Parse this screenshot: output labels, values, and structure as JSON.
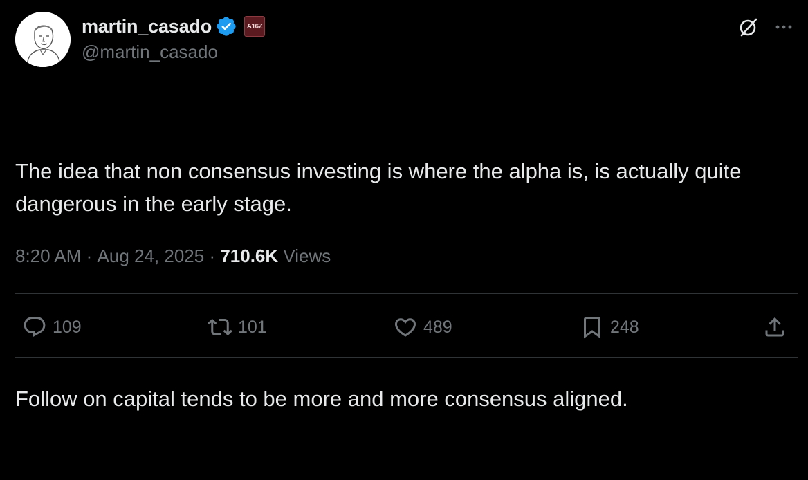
{
  "author": {
    "display_name": "martin_casado",
    "handle": "@martin_casado",
    "verified_icon": "verified-check-icon",
    "affiliation_badge_text": "A16Z"
  },
  "tweet": {
    "paragraphs": [
      "The idea that non consensus investing is where the alpha is, is actually quite dangerous in the early stage.",
      "Follow on capital tends to be more and more consensus aligned."
    ]
  },
  "meta": {
    "time": "8:20 AM",
    "separator": " · ",
    "date": "Aug 24, 2025",
    "views_count": "710.6K",
    "views_label": " Views"
  },
  "actions": {
    "reply_count": "109",
    "retweet_count": "101",
    "like_count": "489",
    "bookmark_count": "248"
  },
  "colors": {
    "background": "#000000",
    "primary_text": "#e7e9ea",
    "secondary_text": "#71767b",
    "verified_blue": "#1d9bf0",
    "divider": "#2f3336"
  }
}
